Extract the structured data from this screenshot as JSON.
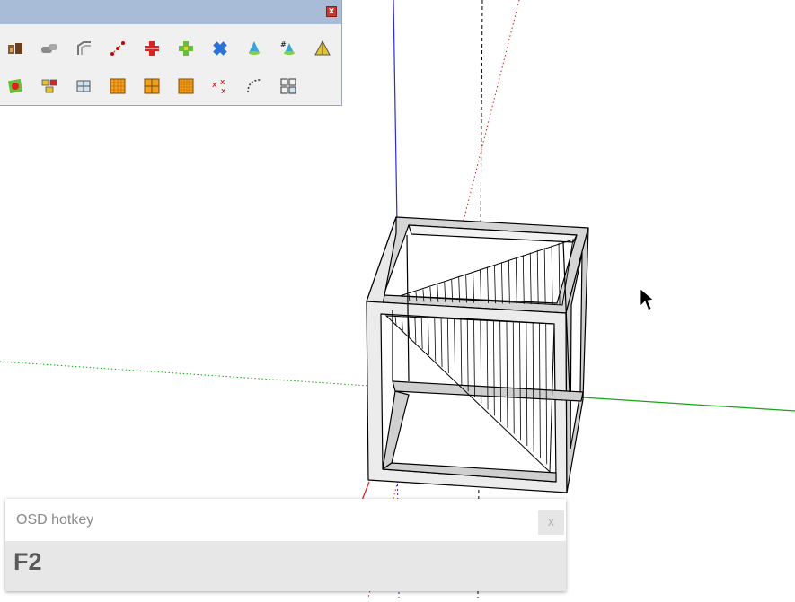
{
  "toolbar": {
    "close_label": "x",
    "row1": [
      "walls-icon",
      "pipes-icon",
      "profile-icon",
      "points-icon",
      "move-cross-icon",
      "offset-cross-icon",
      "rotate-icon",
      "cone-icon",
      "hash-cone-icon",
      "triangle-icon"
    ],
    "row2": [
      "paint-icon",
      "components-icon",
      "box-icon",
      "grid-icon",
      "grid-half-icon",
      "grid-fill-icon",
      "scatter-icon",
      "arc-points-icon",
      "array-icon"
    ]
  },
  "osd": {
    "title": "OSD hotkey",
    "close_label": "x",
    "key": "F2"
  },
  "colors": {
    "axis_blue": "#2b2bd6",
    "axis_red": "#d4181b",
    "axis_green": "#17a317"
  }
}
